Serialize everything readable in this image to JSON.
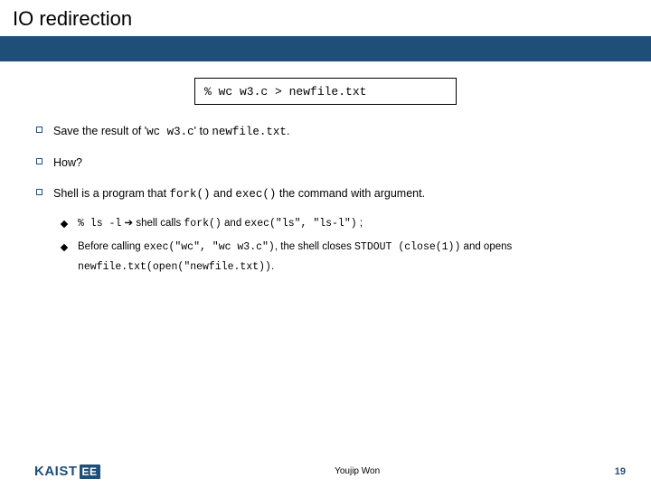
{
  "title": "IO redirection",
  "codebox": "% wc w3.c > newfile.txt",
  "b1": {
    "pre": "Save the result of '",
    "c1": "wc w3.c",
    "mid": "' to ",
    "c2": "newfile.txt",
    "post": "."
  },
  "b2": "How?",
  "b3": {
    "pre": "Shell is a program that ",
    "c1": "fork()",
    "mid": " and ",
    "c2": "exec()",
    "post": " the command with argument."
  },
  "s1": {
    "c1": "% ls -l",
    "arrow": " ➔ ",
    "t1": "shell calls ",
    "c2": "fork()",
    "t2": " and ",
    "c3": "exec(\"ls\", \"ls-l\")",
    "t3": " ;"
  },
  "s2": {
    "t1": "Before calling ",
    "c1": "exec(\"wc\", \"wc w3.c\")",
    "t2": ", the shell closes ",
    "c2": "STDOUT (close(1))",
    "t3": " and opens ",
    "c3": "newfile.txt(open(\"newfile.txt))",
    "t4": "."
  },
  "footer": {
    "logo_main": "KAIST",
    "logo_ee": "EE",
    "author": "Youjip Won",
    "page": "19"
  }
}
